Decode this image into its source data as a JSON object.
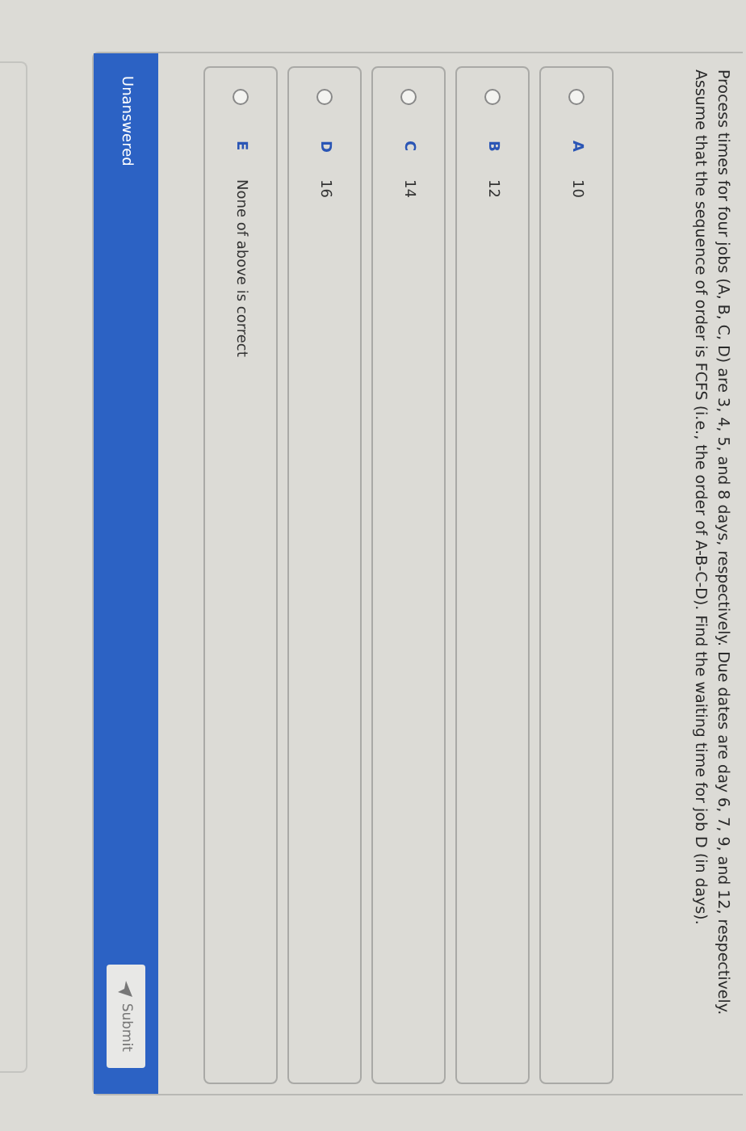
{
  "question": "Process times for four jobs (A, B, C, D) are 3, 4, 5, and 8 days, respectively. Due dates are day 6, 7, 9, and 12, respectively. Assume that the sequence of order is FCFS (i.e., the order of A-B-C-D). Find the waiting time for job D (in days).",
  "options": [
    {
      "letter": "A",
      "text": "10",
      "selected": false
    },
    {
      "letter": "B",
      "text": "12",
      "selected": false
    },
    {
      "letter": "C",
      "text": "14",
      "selected": false
    },
    {
      "letter": "D",
      "text": "16",
      "selected": false
    },
    {
      "letter": "E",
      "text": "None of above is correct",
      "selected": false
    }
  ],
  "status": "Unanswered",
  "submit": "Submit"
}
